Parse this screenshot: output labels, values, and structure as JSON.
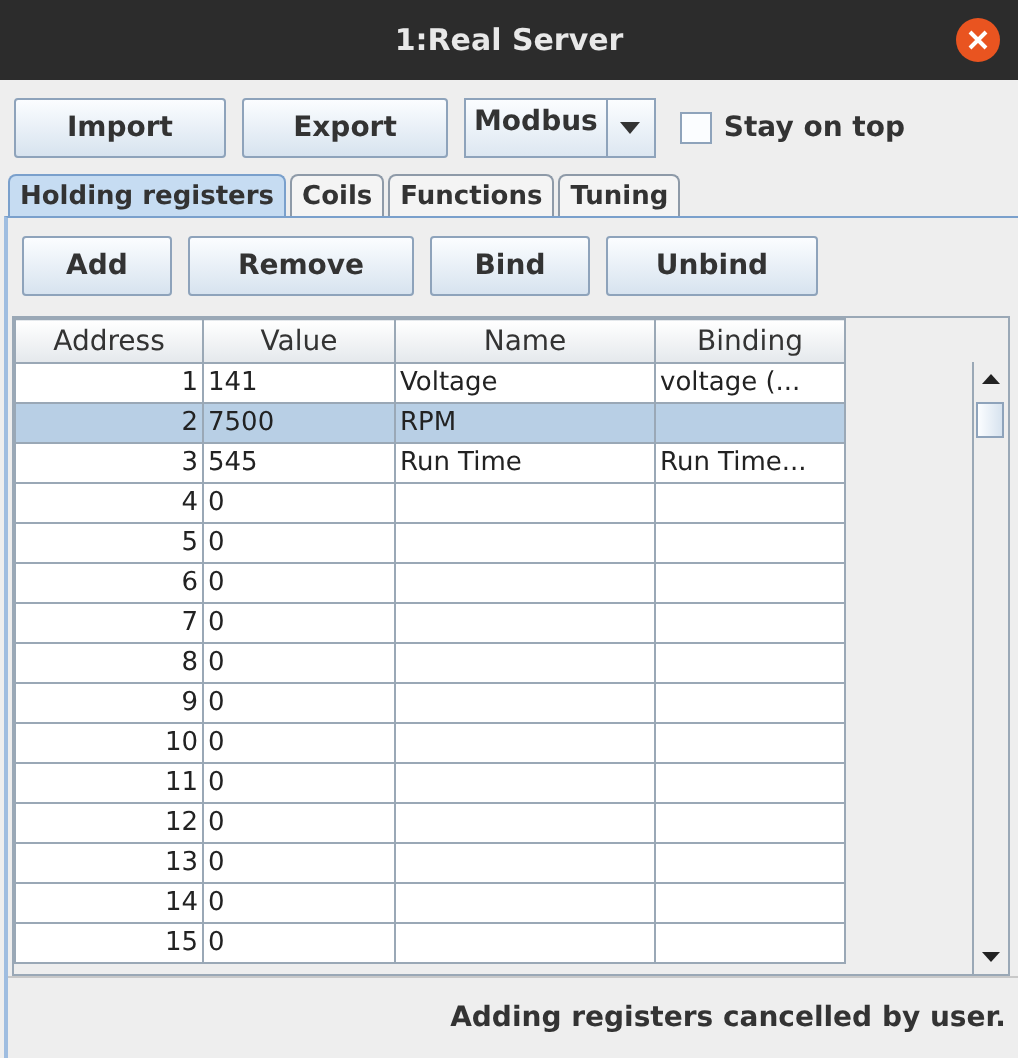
{
  "window": {
    "title": "1:Real Server"
  },
  "toolbar": {
    "buttons": [
      "Import",
      "Export"
    ],
    "protocol": "Modbus",
    "stay_on_top": {
      "label": "Stay on top",
      "checked": false
    }
  },
  "tabs": [
    {
      "label": "Holding registers",
      "selected": true
    },
    {
      "label": "Coils",
      "selected": false
    },
    {
      "label": "Functions",
      "selected": false
    },
    {
      "label": "Tuning",
      "selected": false
    }
  ],
  "actions": [
    "Add",
    "Remove",
    "Bind",
    "Unbind"
  ],
  "table": {
    "columns": [
      "Address",
      "Value",
      "Name",
      "Binding"
    ],
    "rows": [
      {
        "address": "1",
        "value": "141",
        "name": "Voltage",
        "binding": "voltage (...",
        "selected": false
      },
      {
        "address": "2",
        "value": "7500",
        "name": "RPM",
        "binding": "",
        "selected": true
      },
      {
        "address": "3",
        "value": "545",
        "name": "Run Time",
        "binding": "Run Time...",
        "selected": false
      },
      {
        "address": "4",
        "value": "0",
        "selected": false
      },
      {
        "address": "5",
        "value": "0",
        "selected": false
      },
      {
        "address": "6",
        "value": "0",
        "selected": false
      },
      {
        "address": "7",
        "value": "0",
        "selected": false
      },
      {
        "address": "8",
        "value": "0",
        "selected": false
      },
      {
        "address": "9",
        "value": "0",
        "selected": false
      },
      {
        "address": "10",
        "value": "0",
        "selected": false
      },
      {
        "address": "11",
        "value": "0",
        "selected": false
      },
      {
        "address": "12",
        "value": "0",
        "selected": false
      },
      {
        "address": "13",
        "value": "0",
        "selected": false
      },
      {
        "address": "14",
        "value": "0",
        "selected": false
      },
      {
        "address": "15",
        "value": "0",
        "selected": false
      }
    ]
  },
  "status_bar": "Adding registers cancelled by user."
}
